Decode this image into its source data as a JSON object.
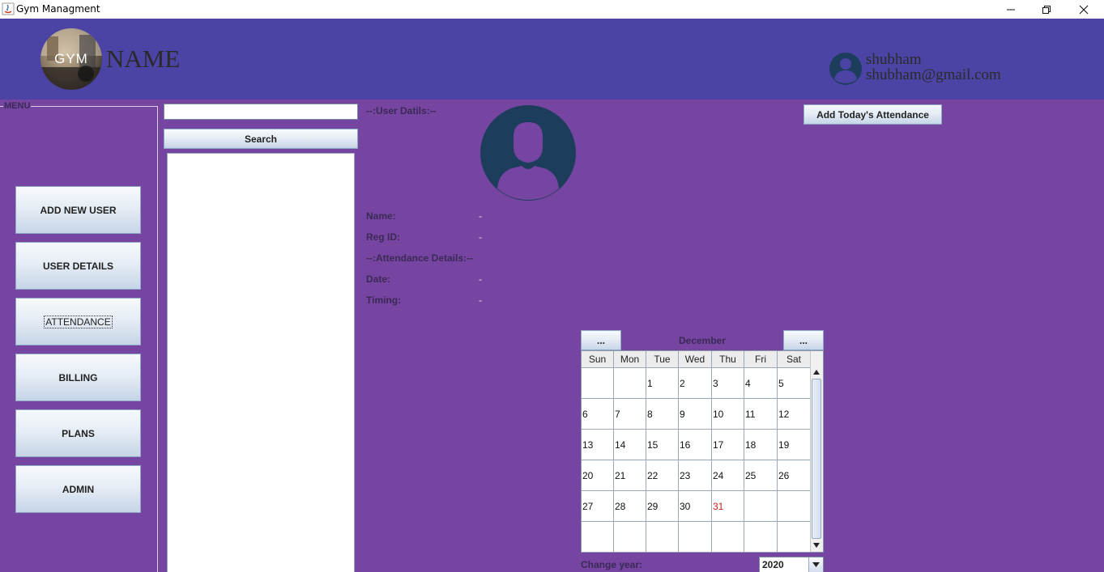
{
  "window": {
    "title": "Gym Managment"
  },
  "header": {
    "logo_text": "GYM",
    "brand_name": "NAME",
    "user_name": "shubham",
    "user_email": "shubham@gmail.com"
  },
  "menu": {
    "label": "MENU",
    "items": [
      {
        "label": "ADD NEW USER"
      },
      {
        "label": "USER DETAILS"
      },
      {
        "label": "ATTENDANCE"
      },
      {
        "label": "BILLING"
      },
      {
        "label": "PLANS"
      },
      {
        "label": "ADMIN"
      }
    ]
  },
  "search": {
    "value": "",
    "button_label": "Search"
  },
  "details": {
    "user_section": "--:User Datils:--",
    "name_label": "Name:",
    "name_value": "-",
    "reg_label": "Reg ID:",
    "reg_value": "-",
    "attendance_section": "--:Attendance Details:--",
    "date_label": "Date:",
    "date_value": "-",
    "timing_label": "Timing:",
    "timing_value": "-"
  },
  "attendance_button_label": "Add Today's Attendance",
  "calendar": {
    "prev_label": "...",
    "next_label": "...",
    "month": "December",
    "weekdays": [
      "Sun",
      "Mon",
      "Tue",
      "Wed",
      "Thu",
      "Fri",
      "Sat"
    ],
    "weeks": [
      [
        "",
        "",
        "1",
        "2",
        "3",
        "4",
        "5"
      ],
      [
        "6",
        "7",
        "8",
        "9",
        "10",
        "11",
        "12"
      ],
      [
        "13",
        "14",
        "15",
        "16",
        "17",
        "18",
        "19"
      ],
      [
        "20",
        "21",
        "22",
        "23",
        "24",
        "25",
        "26"
      ],
      [
        "27",
        "28",
        "29",
        "30",
        "31",
        "",
        ""
      ],
      [
        "",
        "",
        "",
        "",
        "",
        "",
        ""
      ]
    ],
    "highlighted_day": "31",
    "highlight_color": "#d21a1a",
    "change_year_label": "Change year:",
    "year": "2020"
  },
  "colors": {
    "header": "#4b44a4",
    "main": "#7644a1",
    "avatar": "#1d3d5c"
  }
}
